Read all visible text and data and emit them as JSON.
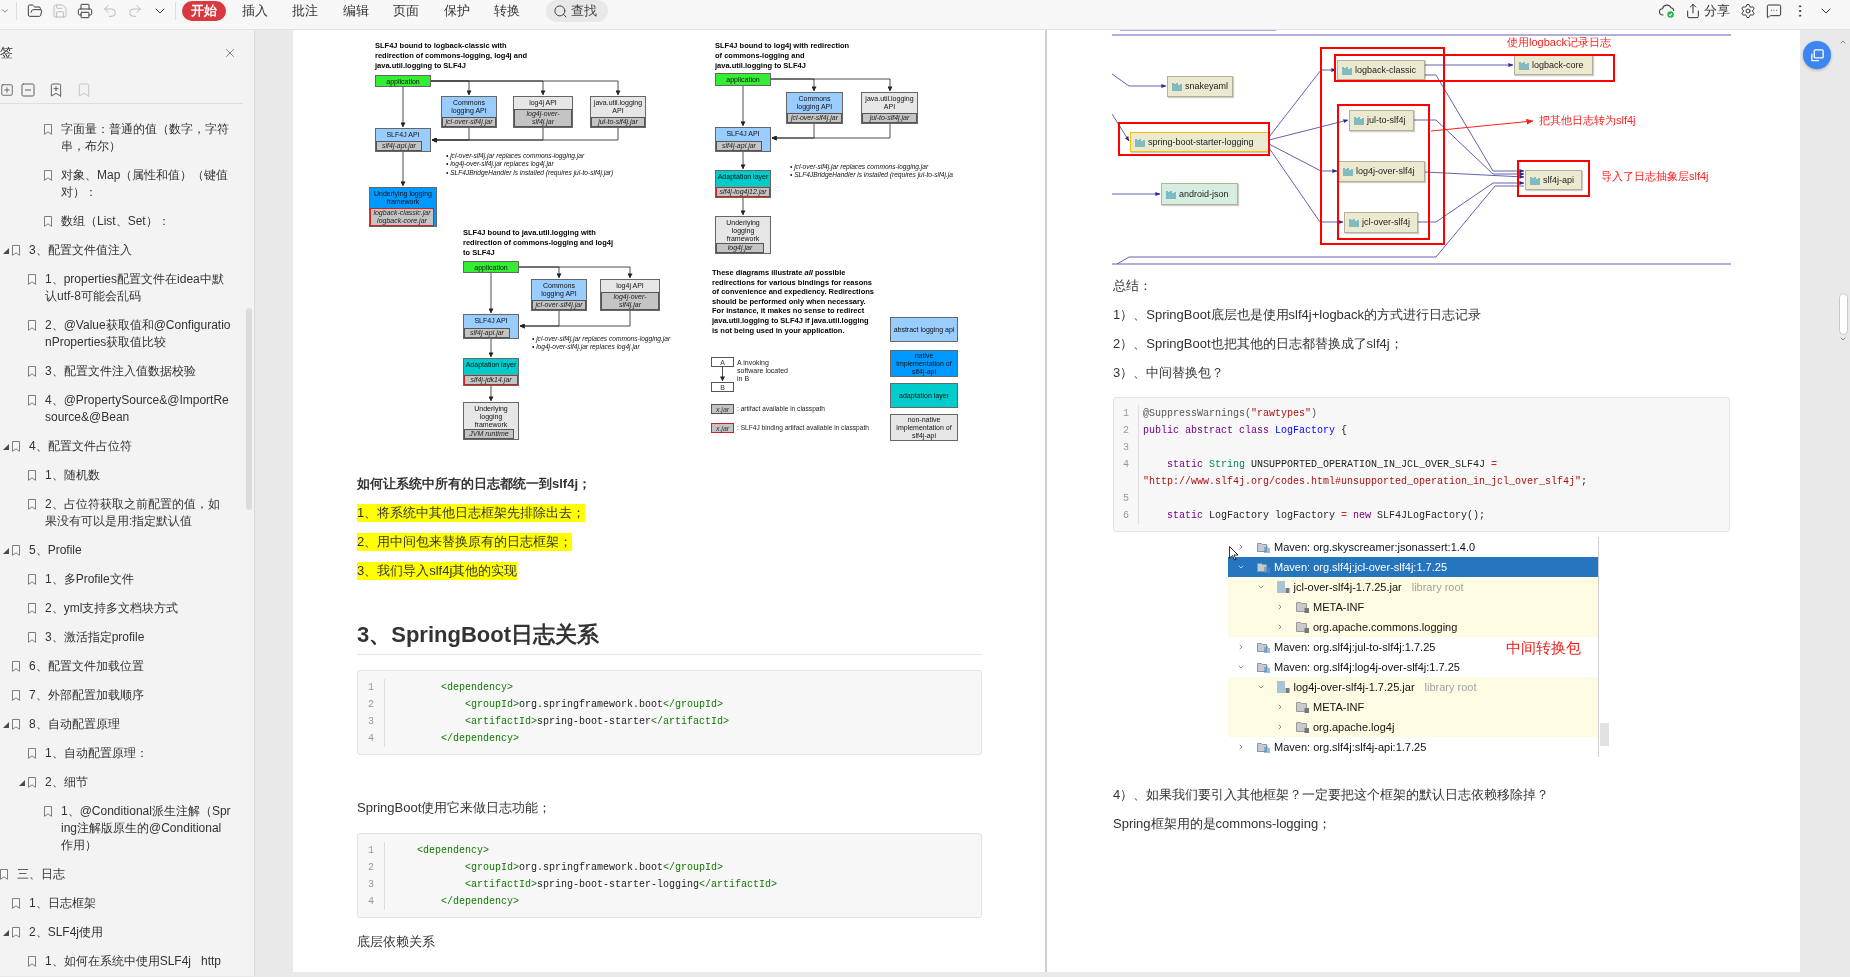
{
  "toolbar": {
    "actions": [
      {
        "kind": "chevron",
        "disabled": false
      },
      {
        "kind": "open",
        "disabled": false
      },
      {
        "kind": "save",
        "disabled": true
      },
      {
        "kind": "print",
        "disabled": false
      },
      {
        "kind": "undo",
        "disabled": true
      },
      {
        "kind": "redo",
        "disabled": true
      },
      {
        "kind": "dropdown",
        "disabled": false
      }
    ],
    "tabs": [
      {
        "label": "开始",
        "selected": true
      },
      {
        "label": "插入",
        "selected": false
      },
      {
        "label": "批注",
        "selected": false
      },
      {
        "label": "编辑",
        "selected": false
      },
      {
        "label": "页面",
        "selected": false
      },
      {
        "label": "保护",
        "selected": false
      },
      {
        "label": "转换",
        "selected": false
      }
    ],
    "search": {
      "label": "查找"
    },
    "right_actions": [
      {
        "kind": "cloud"
      },
      {
        "kind": "share",
        "label": "分享"
      },
      {
        "kind": "settings"
      },
      {
        "kind": "comment"
      },
      {
        "kind": "more"
      },
      {
        "kind": "collapse"
      }
    ]
  },
  "sidebar": {
    "title": "签",
    "tools": [
      {
        "kind": "expand",
        "disabled": false
      },
      {
        "kind": "collapse",
        "disabled": false
      },
      {
        "kind": "add",
        "disabled": false
      },
      {
        "kind": "bookmark",
        "disabled": true
      }
    ],
    "bookmarks": [
      {
        "children": [
          {
            "children": [
              {
                "children": [
                  {
                    "label": "字面量：普通的值（数字，字符串，布尔）"
                  },
                  {
                    "label": "对象、Map（属性和值）（键值对）："
                  },
                  {
                    "label": "数组（List、Set）："
                  }
                ]
              }
            ]
          },
          {
            "label": "3、配置文件值注入",
            "expanded": true,
            "children": [
              {
                "label": "1、properties配置文件在idea中默认utf-8可能会乱码"
              },
              {
                "label": "2、@Value获取值和@ConfigurationProperties获取值比较"
              },
              {
                "label": "3、配置文件注入值数据校验"
              },
              {
                "label": "4、@PropertySource&@ImportResource&@Bean"
              }
            ]
          },
          {
            "label": "4、配置文件占位符",
            "expanded": true,
            "children": [
              {
                "label": "1、随机数"
              },
              {
                "label": "2、占位符获取之前配置的值，如果没有可以是用:指定默认值"
              }
            ]
          },
          {
            "label": "5、Profile",
            "expanded": true,
            "children": [
              {
                "label": "1、多Profile文件"
              },
              {
                "label": "2、yml支持多文档块方式"
              },
              {
                "label": "3、激活指定profile"
              }
            ]
          },
          {
            "label": "6、配置文件加载位置"
          },
          {
            "label": "7、外部配置加载顺序"
          },
          {
            "label": "8、自动配置原理",
            "expanded": true,
            "children": [
              {
                "label": "1、自动配置原理："
              },
              {
                "label": "2、细节",
                "expanded": true,
                "children": [
                  {
                    "label": "1、@Conditional派生注解（Spring注解版原生的@Conditional作用）"
                  }
                ]
              }
            ]
          }
        ]
      },
      {
        "label": "三、日志",
        "children": [
          {
            "label": "1、日志框架"
          },
          {
            "label": "2、SLF4j使用",
            "expanded": true,
            "children": [
              {
                "label": "1、如何在系统中使用SLF4j   http"
              }
            ]
          }
        ]
      }
    ]
  },
  "left_page": {
    "figure": {
      "diagrams": [
        {
          "title": "SLF4J bound to logback-classic with redirection of commons-logging, log4j and java.util.logging to SLF4J",
          "boxes": [
            {
              "kind": "application",
              "label": "application"
            },
            {
              "kind": "abstract",
              "label": "Commons logging API",
              "jar": "jcl-over-slf4j.jar",
              "binding": false
            },
            {
              "kind": "nonnative",
              "label": "log4j API",
              "jar": "log4j-over-slf4j.jar",
              "binding": false
            },
            {
              "kind": "nonnative",
              "label": "java.util.logging API",
              "jar": "jul-to-slf4j.jar",
              "binding": false
            },
            {
              "kind": "abstract",
              "label": "SLF4J API",
              "jar": "slf4j-api.jar",
              "binding": false
            },
            {
              "kind": "native",
              "label": "Underlying logging framework",
              "jar": "logback-classic.jar logback-core.jar",
              "binding": true
            }
          ],
          "notes": [
            "• jcl-over-slf4j.jar replaces commons-logging.jar",
            "• log4j-over-slf4j.jar replaces log4j.jar",
            "• SLF4JBridgeHandler is installed (requires jul-to-slf4j.jar)"
          ]
        },
        {
          "title": "SLF4J bound to log4j with redirection of commons-logging and java.util.logging to SLF4J",
          "boxes": [
            {
              "kind": "application",
              "label": "application"
            },
            {
              "kind": "abstract",
              "label": "Commons logging API",
              "jar": "jcl-over-slf4j.jar",
              "binding": false
            },
            {
              "kind": "nonnative",
              "label": "java.util.logging API",
              "jar": "jul-to-slf4j.jar",
              "binding": false
            },
            {
              "kind": "abstract",
              "label": "SLF4J API",
              "jar": "slf4j-api.jar",
              "binding": false
            },
            {
              "kind": "adaptation",
              "label": "Adaptation layer",
              "jar": "slf4j-log4j12.jar",
              "binding": true
            },
            {
              "kind": "nonnative",
              "label": "Underlying logging framework",
              "jar": "log4j.jar",
              "binding": false
            }
          ],
          "notes": [
            "• jcl-over-slf4j.jar replaces commons-logging.jar",
            "• SLF4JBridgeHandler is installed (requires jul-to-slf4j.ja"
          ]
        },
        {
          "title": "SLF4J bound to java.util.logging with redirection of commons-logging and log4j to SLF4J",
          "boxes": [
            {
              "kind": "application",
              "label": "application"
            },
            {
              "kind": "abstract",
              "label": "Commons logging API",
              "jar": "jcl-over-slf4j.jar",
              "binding": false
            },
            {
              "kind": "nonnative",
              "label": "log4j API",
              "jar": "log4j-over-slf4j.jar",
              "binding": false
            },
            {
              "kind": "abstract",
              "label": "SLF4J API",
              "jar": "slf4j-api.jar",
              "binding": false
            },
            {
              "kind": "adaptation",
              "label": "Adaptation layer",
              "jar": "slf4j-jdk14.jar",
              "binding": true
            },
            {
              "kind": "nonnative",
              "label": "Underlying logging framework",
              "jar": "JVM runtime",
              "binding": false
            }
          ],
          "notes": [
            "• jcl-over-slf4j.jar replaces commons-logging.jar",
            "• log4j-over-slf4j.jar replaces log4j.jar"
          ]
        }
      ],
      "legend": {
        "paragraph": "These diagrams illustrate *all* possible redirections for various bindings for reasons of convenience and expediency. Redirections should be performed only when necessary. For instance, it makes no sense to redirect java.util.logging to SLF4J if java.util.logging is not being used in your application.",
        "invoke": {
          "a": "A",
          "b": "B",
          "text": "A invoking software located in B"
        },
        "jars": [
          {
            "label": "x.jar",
            "binding": false,
            "text": ": artifact available in classpath"
          },
          {
            "label": "x.jar",
            "binding": true,
            "text": ": SLF4J binding artifact available in classpath"
          }
        ],
        "swatches": [
          {
            "kind": "abstract",
            "label": "abstract logging api"
          },
          {
            "kind": "native",
            "label": "native implementation of slf4j-api"
          },
          {
            "kind": "adaptation",
            "label": "adaptation layer"
          },
          {
            "kind": "nonnative",
            "label": "non-native implementation of slf4j-api"
          }
        ]
      }
    },
    "question": "如何让系统中所有的日志都统一到slf4j；",
    "steps": [
      "1、将系统中其他日志框架先排除出去；",
      "2、用中间包来替换原有的日志框架；",
      "3、我们导入slf4j其他的实现"
    ],
    "heading": "3、SpringBoot日志关系",
    "code_1": {
      "lines": [
        {
          "number": "1",
          "tokens": [
            {
              "kind": "tag",
              "text": "        <dependency>"
            }
          ]
        },
        {
          "number": "2",
          "tokens": [
            {
              "kind": "tag",
              "text": "            <groupId>"
            },
            {
              "kind": "plain",
              "text": "org.springframework.boot"
            },
            {
              "kind": "tag",
              "text": "</groupId>"
            }
          ]
        },
        {
          "number": "3",
          "tokens": [
            {
              "kind": "tag",
              "text": "            <artifactId>"
            },
            {
              "kind": "plain",
              "text": "spring-boot-starter"
            },
            {
              "kind": "tag",
              "text": "</artifactId>"
            }
          ]
        },
        {
          "number": "4",
          "tokens": [
            {
              "kind": "tag",
              "text": "        </dependency>"
            }
          ]
        }
      ]
    },
    "caption": "SpringBoot使用它来做日志功能；",
    "code_2": {
      "lines": [
        {
          "number": "1",
          "tokens": [
            {
              "kind": "tag",
              "text": "    <dependency>"
            }
          ]
        },
        {
          "number": "2",
          "tokens": [
            {
              "kind": "tag",
              "text": "            <groupId>"
            },
            {
              "kind": "plain",
              "text": "org.springframework.boot"
            },
            {
              "kind": "tag",
              "text": "</groupId>"
            }
          ]
        },
        {
          "number": "3",
          "tokens": [
            {
              "kind": "tag",
              "text": "            <artifactId>"
            },
            {
              "kind": "plain",
              "text": "spring-boot-starter-logging"
            },
            {
              "kind": "tag",
              "text": "</artifactId>"
            }
          ]
        },
        {
          "number": "4",
          "tokens": [
            {
              "kind": "tag",
              "text": "        </dependency>"
            }
          ]
        }
      ]
    },
    "footer_text": "底层依赖关系"
  },
  "right_page": {
    "dependency_graph": {
      "nodes": [
        {
          "label": "snakeyaml",
          "selected": false,
          "color": "#ebe9cf"
        },
        {
          "label": "spring-boot-starter-logging",
          "selected": true,
          "color": "#ebe9cf"
        },
        {
          "label": "android-json",
          "selected": false,
          "color": "#d6eee0"
        },
        {
          "label": "logback-classic",
          "selected": false,
          "color": "#ebe9cf"
        },
        {
          "label": "logback-core",
          "selected": false,
          "color": "#ebe9cf"
        },
        {
          "label": "jul-to-slf4j",
          "selected": false,
          "color": "#ebe9cf"
        },
        {
          "label": "log4j-over-slf4j",
          "selected": false,
          "color": "#ebe9cf"
        },
        {
          "label": "jcl-over-slf4j",
          "selected": false,
          "color": "#ebe9cf"
        },
        {
          "label": "slf4j-api",
          "selected": false,
          "color": "#ebe9cf"
        }
      ],
      "annotations": [
        "使用logback记录日志",
        "把其他日志转为slf4j",
        "导入了日志抽象层slf4j"
      ]
    },
    "summary_title": "总结：",
    "summary": [
      "1）、SpringBoot底层也是使用slf4j+logback的方式进行日志记录",
      "2）、SpringBoot也把其他的日志都替换成了slf4j；",
      "3）、中间替换包？"
    ],
    "code": {
      "lines": [
        {
          "number": "1",
          "tokens": [
            {
              "kind": "meta",
              "text": "@SuppressWarnings("
            },
            {
              "kind": "string",
              "text": "\"rawtypes\""
            },
            {
              "kind": "meta",
              "text": ")"
            }
          ]
        },
        {
          "number": "2",
          "tokens": [
            {
              "kind": "keyword",
              "text": "public abstract class "
            },
            {
              "kind": "def",
              "text": "LogFactory"
            },
            {
              "kind": "plain",
              "text": " {"
            }
          ]
        },
        {
          "number": "3"
        },
        {
          "number": "4",
          "tokens": [
            {
              "kind": "keyword",
              "text": "    static "
            },
            {
              "kind": "type",
              "text": "String"
            },
            {
              "kind": "plain",
              "text": " UNSUPPORTED_OPERATION_IN_JCL_OVER_SLF4J "
            },
            {
              "kind": "operator",
              "text": "= "
            },
            {
              "kind": "string",
              "text": "\"http://www.slf4j.org/codes.html#unsupported_operation_in_jcl_over_slf4j\""
            },
            {
              "kind": "plain",
              "text": ";"
            }
          ]
        },
        {
          "number": "5"
        },
        {
          "number": "6",
          "tokens": [
            {
              "kind": "keyword",
              "text": "    static"
            },
            {
              "kind": "plain",
              "text": " LogFactory logFactory "
            },
            {
              "kind": "operator",
              "text": "= "
            },
            {
              "kind": "keyword",
              "text": "new"
            },
            {
              "kind": "plain",
              "text": " SLF4JLogFactory();"
            }
          ]
        }
      ]
    },
    "library_tree": {
      "items": [
        {
          "kind": "library",
          "label": "Maven: org.skyscreamer:jsonassert:1.4.0",
          "expanded": false,
          "selected": false
        },
        {
          "kind": "library",
          "label": "Maven: org.slf4j:jcl-over-slf4j:1.7.25",
          "expanded": true,
          "selected": true,
          "children": [
            {
              "kind": "jar",
              "label": "jcl-over-slf4j-1.7.25.jar",
              "note": "library root",
              "expanded": true,
              "selected": false,
              "children": [
                {
                  "kind": "package",
                  "label": "META-INF",
                  "expanded": false,
                  "selected": false
                },
                {
                  "kind": "package",
                  "label": "org.apache.commons.logging",
                  "expanded": false,
                  "selected": false
                }
              ]
            }
          ]
        },
        {
          "kind": "library",
          "label": "Maven: org.slf4j:jul-to-slf4j:1.7.25",
          "expanded": false,
          "selected": false
        },
        {
          "kind": "library",
          "label": "Maven: org.slf4j:log4j-over-slf4j:1.7.25",
          "expanded": true,
          "selected": false,
          "children": [
            {
              "kind": "jar",
              "label": "log4j-over-slf4j-1.7.25.jar",
              "note": "library root",
              "expanded": true,
              "selected": false,
              "children": [
                {
                  "kind": "package",
                  "label": "META-INF",
                  "expanded": false,
                  "selected": false
                },
                {
                  "kind": "package",
                  "label": "org.apache.log4j",
                  "expanded": false,
                  "selected": false
                }
              ]
            }
          ]
        },
        {
          "kind": "library",
          "label": "Maven: org.slf4j:slf4j-api:1.7.25",
          "expanded": false,
          "selected": false
        }
      ],
      "annotation": "中间转换包"
    },
    "paragraphs": [
      "4）、如果我们要引入其他框架？一定要把这个框架的默认日志依赖移除掉？",
      "Spring框架用的是commons-logging；"
    ]
  }
}
